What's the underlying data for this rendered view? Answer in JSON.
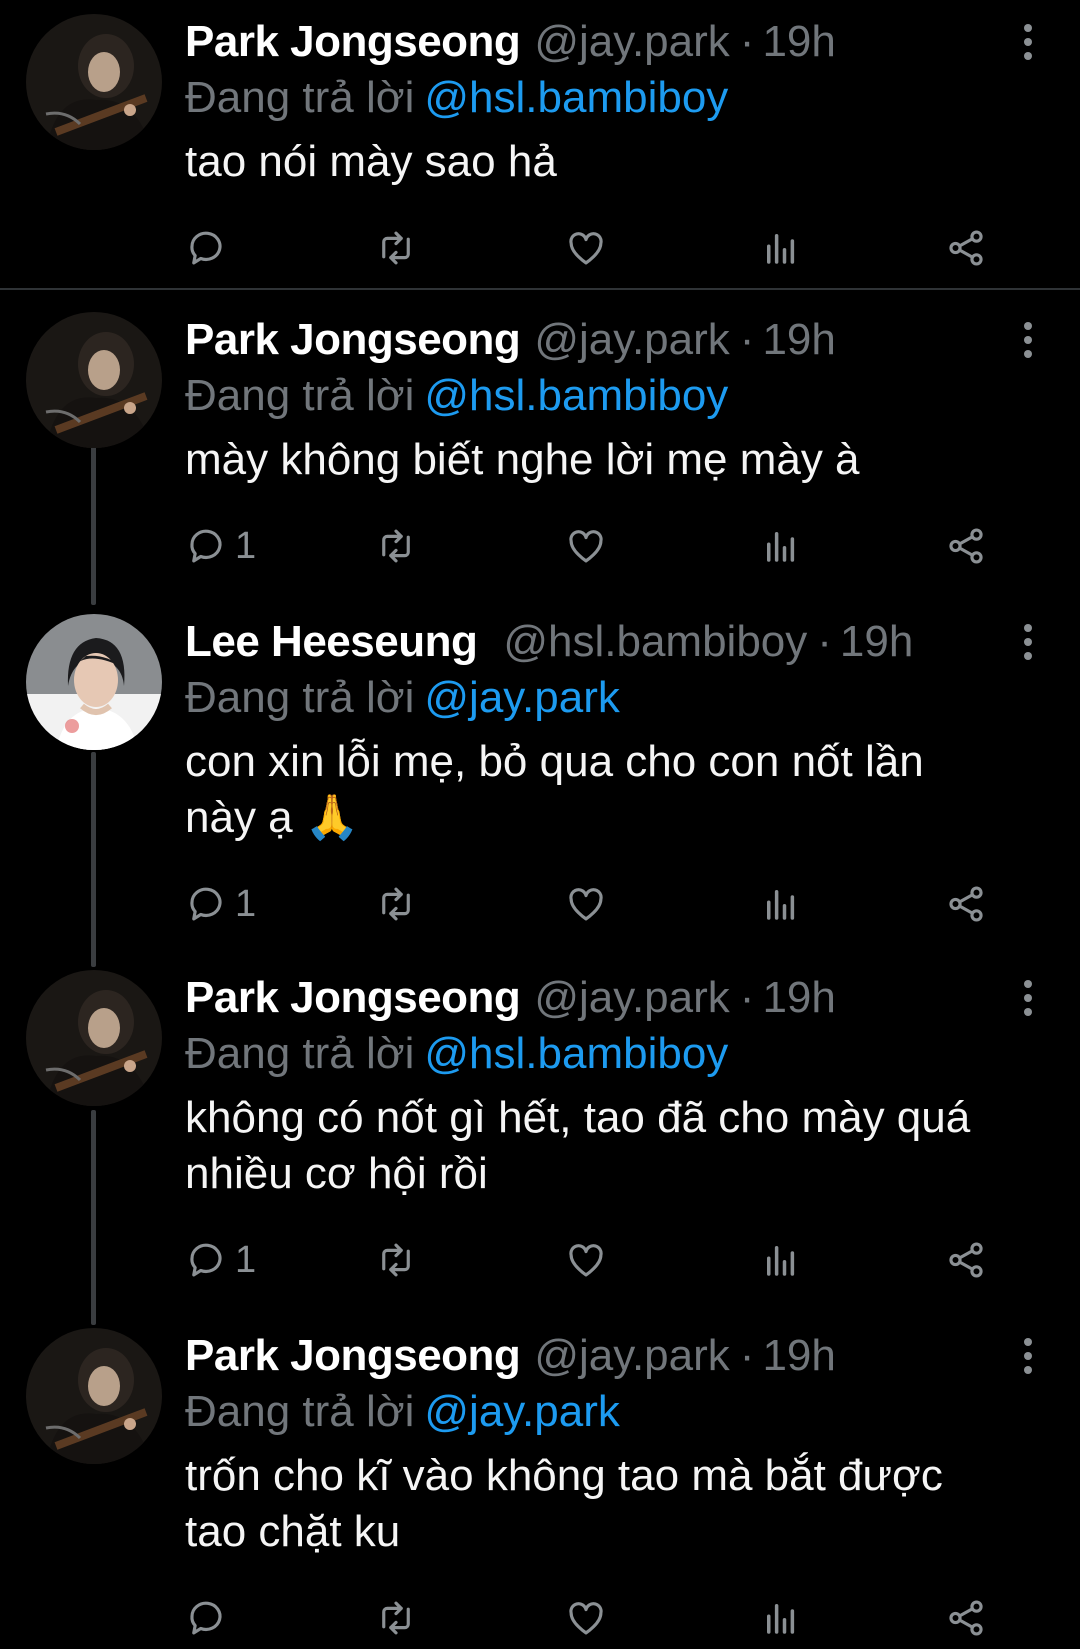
{
  "replying_label": "Đang trả lời",
  "tweets": [
    {
      "name": "Park Jongseong",
      "handle": "@jay.park",
      "separator": "·",
      "time": "19h",
      "reply_to": "@hsl.bambiboy",
      "text": "tao nói mày sao hả",
      "reply_count": "",
      "avatar": "jay-avatar"
    },
    {
      "name": "Park Jongseong",
      "handle": "@jay.park",
      "separator": "·",
      "time": "19h",
      "reply_to": "@hsl.bambiboy",
      "text": "mày không biết nghe lời mẹ mày à",
      "reply_count": "1",
      "avatar": "jay-avatar"
    },
    {
      "name": "Lee Heeseung",
      "handle": "@hsl.bambiboy",
      "separator": "·",
      "time": "19h",
      "reply_to": "@jay.park",
      "text": "con xin lỗi mẹ, bỏ qua cho con nốt lần\nnày ạ 🙏",
      "reply_count": "1",
      "avatar": "heeseung-avatar"
    },
    {
      "name": "Park Jongseong",
      "handle": "@jay.park",
      "separator": "·",
      "time": "19h",
      "reply_to": "@hsl.bambiboy",
      "text": "không có nốt gì hết, tao đã cho mày quá\nnhiều cơ hội rồi",
      "reply_count": "1",
      "avatar": "jay-avatar"
    },
    {
      "name": "Park Jongseong",
      "handle": "@jay.park",
      "separator": "·",
      "time": "19h",
      "reply_to": "@jay.park",
      "text": "trốn cho kĩ vào không tao mà bắt được\ntao chặt ku",
      "reply_count": "",
      "avatar": "jay-avatar"
    }
  ],
  "icons": {
    "reply": "reply-icon",
    "retweet": "retweet-icon",
    "like": "heart-icon",
    "views": "views-icon",
    "share": "share-icon",
    "more": "more-icon"
  },
  "colors": {
    "background": "#000000",
    "name": "#ffffff",
    "muted": "#71767b",
    "link": "#1d9bf0",
    "thread_line": "#3a3d40"
  }
}
